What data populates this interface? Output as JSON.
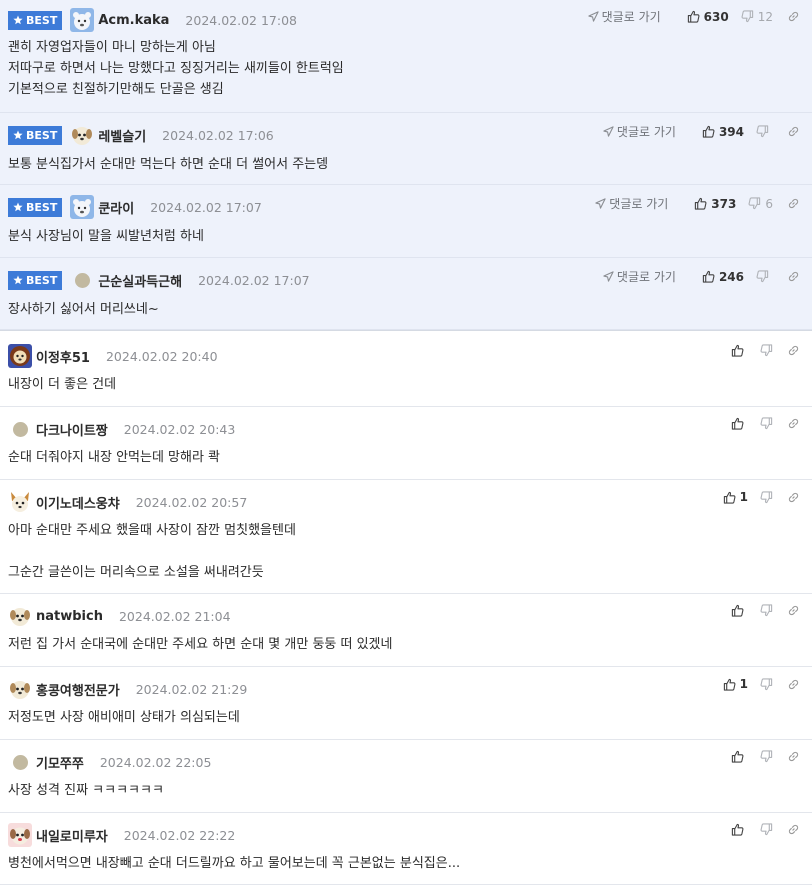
{
  "labels": {
    "best": "BEST",
    "goto_reply": "댓글로 가기"
  },
  "best_comments": [
    {
      "nick": "Acm.kaka",
      "time": "2024.02.02 17:08",
      "up": "630",
      "down": "12",
      "body": "괜히 자영업자들이 마니 망하는게 아님\n저따구로 하면서 나는 망했다고 징징거리는 새끼들이 한트럭임\n기본적으로 친절하기만해도 단골은 생김",
      "avatar": "bear-avatar-icon"
    },
    {
      "nick": "레벨슬기",
      "time": "2024.02.02 17:06",
      "up": "394",
      "down": "",
      "body": "보통 분식집가서 순대만 먹는다 하면 순대 더 썰어서 주는뎅",
      "avatar": "puppy-avatar-icon"
    },
    {
      "nick": "쿤라이",
      "time": "2024.02.02 17:07",
      "up": "373",
      "down": "6",
      "body": "분식 사장님이 말을 씨발년처럼 하네",
      "avatar": "bear-avatar-icon"
    },
    {
      "nick": "근순실과득근해",
      "time": "2024.02.02 17:07",
      "up": "246",
      "down": "",
      "body": "장사하기 싫어서 머리쓰네~",
      "avatar": "dot-avatar-icon"
    }
  ],
  "comments": [
    {
      "nick": "이정후51",
      "time": "2024.02.02 20:40",
      "up": "",
      "body": "내장이 더 좋은 건데",
      "avatar": "lion-avatar-icon"
    },
    {
      "nick": "다크나이트짱",
      "time": "2024.02.02 20:43",
      "up": "",
      "body": "순대 더줘야지 내장 안먹는데 망해라 콱",
      "avatar": "dot-avatar-icon"
    },
    {
      "nick": "이기노데스웅챠",
      "time": "2024.02.02 20:57",
      "up": "1",
      "body": "아마 순대만 주세요 했을때 사장이 잠깐 멈칫했을텐데\n\n그순간 글쓴이는 머리속으로 소설을 써내려간듯",
      "avatar": "fox-avatar-icon"
    },
    {
      "nick": "natwbich",
      "time": "2024.02.02 21:04",
      "up": "",
      "body": "저런 집 가서 순대국에 순대만 주세요 하면 순대 몇 개만 둥둥 떠 있겠네",
      "avatar": "puppy-avatar-icon"
    },
    {
      "nick": "홍콩여행전문가",
      "time": "2024.02.02 21:29",
      "up": "1",
      "body": "저정도면 사장 애비애미 상태가 의심되는데",
      "avatar": "puppy-avatar-icon"
    },
    {
      "nick": "기모쭈쭈",
      "time": "2024.02.02 22:05",
      "up": "",
      "body": "사장 성격 진짜 ㅋㅋㅋㅋㅋㅋ",
      "avatar": "dot-avatar-icon"
    },
    {
      "nick": "내일로미루자",
      "time": "2024.02.02 22:22",
      "up": "",
      "body": "병천에서먹으면 내장빼고 순대 더드릴까요 하고 물어보는데 꼭 근본없는 분식집은...",
      "avatar": "puppy-red-avatar-icon"
    }
  ]
}
